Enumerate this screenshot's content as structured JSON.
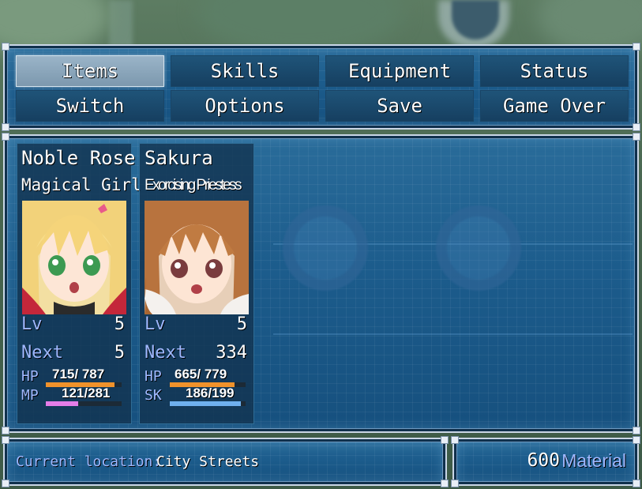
{
  "menu": {
    "commands": [
      {
        "label": "Items",
        "selected": true
      },
      {
        "label": "Skills",
        "selected": false
      },
      {
        "label": "Equipment",
        "selected": false
      },
      {
        "label": "Status",
        "selected": false
      },
      {
        "label": "Switch",
        "selected": false
      },
      {
        "label": "Options",
        "selected": false
      },
      {
        "label": "Save",
        "selected": false
      },
      {
        "label": "Game Over",
        "selected": false
      }
    ]
  },
  "party": [
    {
      "name": "Noble Rose",
      "class": "Magical Girl",
      "lv_label": "Lv",
      "level": "5",
      "next_label": "Next",
      "next": "5",
      "hp_label": "HP",
      "hp": "715",
      "hp_max": "787",
      "hp_ratio": 0.908,
      "mp_label": "MP",
      "mp": "121",
      "mp_max": "281",
      "mp_ratio": 0.43,
      "hp_color": "#f0922b",
      "mp_color": "#e57de8"
    },
    {
      "name": "Sakura",
      "class": "Exorcising Priestess",
      "lv_label": "Lv",
      "level": "5",
      "next_label": "Next",
      "next": "334",
      "hp_label": "HP",
      "hp": "665",
      "hp_max": "779",
      "hp_ratio": 0.854,
      "mp_label": "SK",
      "mp": "186",
      "mp_max": "199",
      "mp_ratio": 0.935,
      "hp_color": "#f0922b",
      "mp_color": "#6fb0ee"
    }
  ],
  "footer": {
    "location_label": "Current location:",
    "location": "City Streets",
    "currency_value": "600",
    "currency_unit": "Material"
  }
}
